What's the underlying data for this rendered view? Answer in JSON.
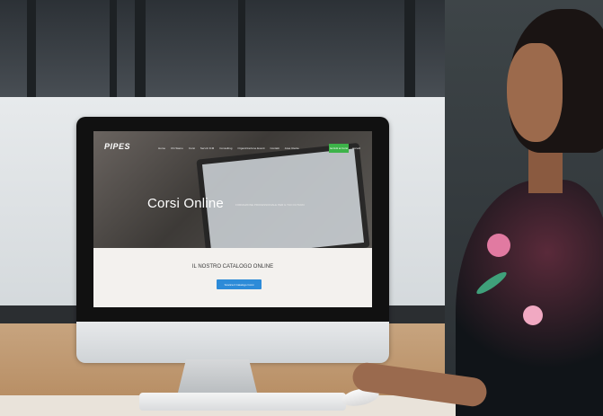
{
  "screen": {
    "logo": "PIPES",
    "nav_items": [
      "Home",
      "Chi Siamo",
      "Corsi",
      "Servizi ICM",
      "Consulting",
      "Organizzazione Eventi",
      "Contatti",
      "Area Utente"
    ],
    "nav_cta": "Iscriviti ai Corsi",
    "nav_login": "Accedi",
    "hero_title": "Corsi Online",
    "hero_subtitle": "FORMAZIONE PROFESSIONALE PER IL TUO FUTURO",
    "catalog_title": "IL NOSTRO CATALOGO ONLINE",
    "catalog_button": "Scarica il Catalogo Corsi"
  },
  "colors": {
    "cta_green": "#3db349",
    "button_blue": "#2d8bd8",
    "band_bg": "#f3f1ee"
  }
}
